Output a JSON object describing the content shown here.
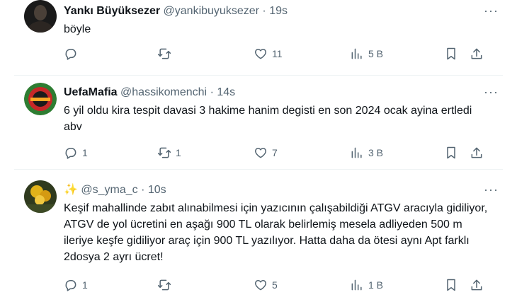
{
  "tweets": [
    {
      "name": "Yankı Büyüksezer",
      "handle": "@yankibuyuksezer",
      "time": "19s",
      "text": "böyle",
      "replies": "",
      "retweets": "",
      "likes": "11",
      "views": "5 B"
    },
    {
      "name": "UefaMafia",
      "handle": "@hassikomenchi",
      "time": "14s",
      "text": "6 yil oldu kira tespit davasi 3 hakime hanim degisti en son 2024 ocak ayina ertledi  abv",
      "replies": "1",
      "retweets": "1",
      "likes": "7",
      "views": "3 B"
    },
    {
      "name": "✨",
      "handle": "@s_yma_c",
      "time": "10s",
      "text": "Keşif mahallinde zabıt alınabilmesi için yazıcının çalışabildiği ATGV aracıyla gidiliyor, ATGV de yol ücretini en aşağı 900 TL olarak belirlemiş mesela adliyeden 500 m ileriye keşfe gidiliyor araç için 900 TL yazılıyor. Hatta daha da ötesi aynı Apt farklı 2dosya 2 ayrı ücret!",
      "replies": "1",
      "retweets": "",
      "likes": "5",
      "views": "1 B"
    }
  ],
  "ui": {
    "separator": "·",
    "more": "···"
  },
  "colors": {
    "text": "#0f1419",
    "muted": "#536471",
    "divider": "#eff3f4"
  },
  "icons": [
    "reply-icon",
    "retweet-icon",
    "like-icon",
    "views-icon",
    "bookmark-icon",
    "share-icon",
    "more-icon"
  ]
}
